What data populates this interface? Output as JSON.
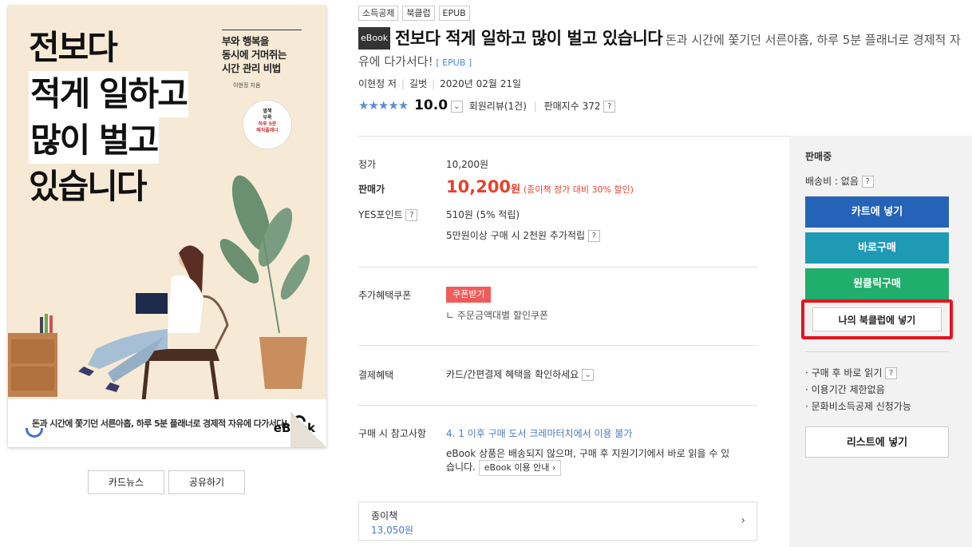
{
  "cover": {
    "title_lines": [
      "전보다",
      "적게 일하고",
      "많이 벌고",
      "있습니다"
    ],
    "subtitle_lines": [
      "부와 행복을",
      "동시에 거머쥐는",
      "시간 관리 비법"
    ],
    "author": "이현정 지음",
    "badge_lines": [
      "별책",
      "부록",
      "하루 5분",
      "메직플래너"
    ],
    "band_text": "돈과 시간에 쫓기던 서른아홉, 하루 5분 플래너로 경제적 자유에 다가서다!",
    "ebook_mark": "eBook"
  },
  "cover_buttons": {
    "card_news": "카드뉴스",
    "share": "공유하기"
  },
  "tags": [
    "소득공제",
    "북클럽",
    "EPUB"
  ],
  "title": {
    "badge": "eBook",
    "main": "전보다 적게 일하고 많이 벌고 있습니다",
    "sub": "돈과 시간에 쫓기던 서른아홉, 하루 5분 플래너로 경제적 자유에 다가서다!",
    "format": "[ EPUB ]"
  },
  "meta": {
    "author": "이현정 저",
    "publisher": "길벗",
    "date": "2020년 02월 21일"
  },
  "rating": {
    "stars": "★★★★★",
    "score": "10.0",
    "reviews": "회원리뷰(1건)",
    "sales_index": "판매지수 372",
    "help": "?"
  },
  "price": {
    "list_label": "정가",
    "list_value": "10,200원",
    "sale_label": "판매가",
    "sale_value": "10,200",
    "sale_unit": "원",
    "sale_note": "(종이책 정가 대비 30% 할인)",
    "points_label": "YES포인트",
    "points_value": "510원 (5% 적립)",
    "points_extra": "5만원이상 구매 시 2천원 추가적립"
  },
  "coupon": {
    "label": "추가혜택쿠폰",
    "button": "쿠폰받기",
    "desc": "∟ 주문금액대별 할인쿠폰"
  },
  "payment": {
    "label": "결제혜택",
    "value": "카드/간편결제 혜택을 확인하세요"
  },
  "notes": {
    "label": "구매 시 참고사항",
    "link": "4. 1 이후 구매 도서 크레마터치에서 이용 불가",
    "text_line1": "eBook 상품은 배송되지 않으며, 구매 후 지원기기에서 바로 읽을 수 있",
    "text_line2": "습니다.",
    "guide_button": "eBook 이용 안내 ›"
  },
  "paper": {
    "label": "종이책",
    "price": "13,050원",
    "chevron": "›"
  },
  "panel": {
    "status": "판매중",
    "shipping": "배송비 : 없음",
    "cart": "카트에 넣기",
    "buy_now": "바로구매",
    "one_click": "원클릭구매",
    "bookclub": "나의 북클럽에 넣기",
    "bullets": [
      "· 구매 후 바로 읽기",
      "· 이용기간 제한없음",
      "· 문화비소득공제 신청가능"
    ],
    "list": "리스트에 넣기"
  },
  "colors": {
    "accent_red": "#e8412c",
    "blue": "#2563b8",
    "teal": "#1e9ab5",
    "green": "#1fae6b",
    "highlight": "#e8131b"
  }
}
